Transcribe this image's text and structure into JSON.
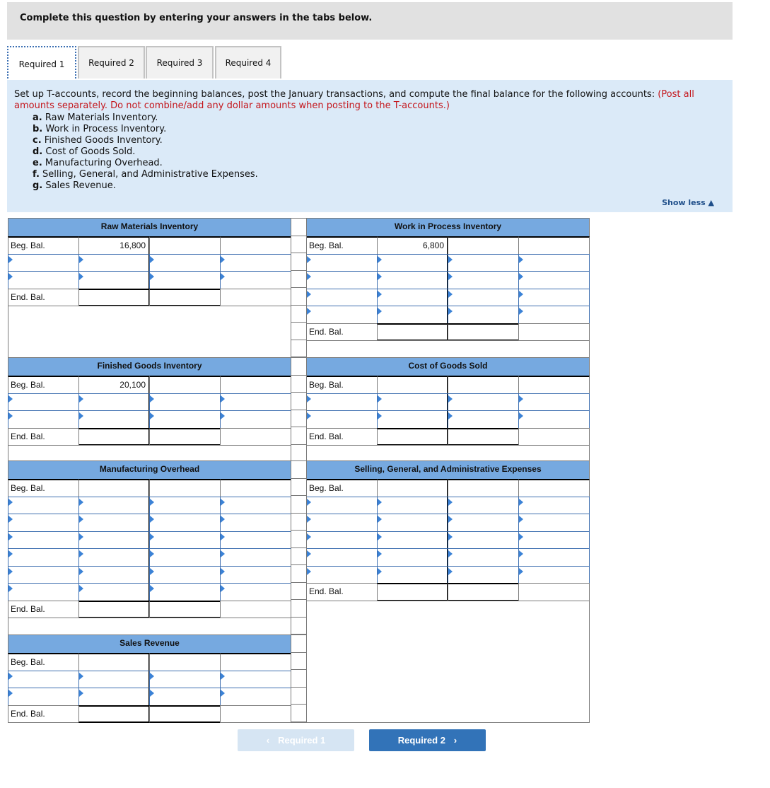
{
  "banner": {
    "text": "Complete this question by entering your answers in the tabs below."
  },
  "tabs": [
    {
      "label": "Required 1",
      "active": true
    },
    {
      "label": "Required 2",
      "active": false
    },
    {
      "label": "Required 3",
      "active": false
    },
    {
      "label": "Required 4",
      "active": false
    }
  ],
  "prompt": {
    "text": "Set up T-accounts, record the beginning balances, post the January transactions, and compute the final balance for the following accounts: ",
    "note": "(Post all amounts separately. Do not combine/add any dollar amounts when posting to the T-accounts.)",
    "items": [
      {
        "letter": "a.",
        "text": "Raw Materials Inventory."
      },
      {
        "letter": "b.",
        "text": "Work in Process Inventory."
      },
      {
        "letter": "c.",
        "text": "Finished Goods Inventory."
      },
      {
        "letter": "d.",
        "text": "Cost of Goods Sold."
      },
      {
        "letter": "e.",
        "text": "Manufacturing Overhead."
      },
      {
        "letter": "f.",
        "text": "Selling, General, and Administrative Expenses."
      },
      {
        "letter": "g.",
        "text": "Sales Revenue."
      }
    ],
    "show_less": "Show less ▲"
  },
  "labels": {
    "beg": "Beg. Bal.",
    "end": "End. Bal."
  },
  "accounts": [
    {
      "id": "raw-materials",
      "title": "Raw Materials Inventory",
      "beg_balance": "16,800",
      "entry_rows": 2,
      "side": "left"
    },
    {
      "id": "work-in-process",
      "title": "Work in Process Inventory",
      "beg_balance": "6,800",
      "entry_rows": 4,
      "side": "right"
    },
    {
      "id": "finished-goods",
      "title": "Finished Goods Inventory",
      "beg_balance": "20,100",
      "entry_rows": 2,
      "side": "left"
    },
    {
      "id": "cost-of-goods-sold",
      "title": "Cost of Goods Sold",
      "beg_balance": "",
      "entry_rows": 2,
      "side": "right"
    },
    {
      "id": "manufacturing-overhead",
      "title": "Manufacturing Overhead",
      "beg_balance": "",
      "entry_rows": 6,
      "side": "left"
    },
    {
      "id": "sga-expenses",
      "title": "Selling, General, and Administrative Expenses",
      "beg_balance": "",
      "entry_rows": 5,
      "side": "right"
    },
    {
      "id": "sales-revenue",
      "title": "Sales Revenue",
      "beg_balance": "",
      "entry_rows": 2,
      "side": "left"
    }
  ],
  "nav": {
    "prev_label": "Required 1",
    "next_label": "Required 2",
    "prev_icon": "‹",
    "next_icon": "›"
  }
}
